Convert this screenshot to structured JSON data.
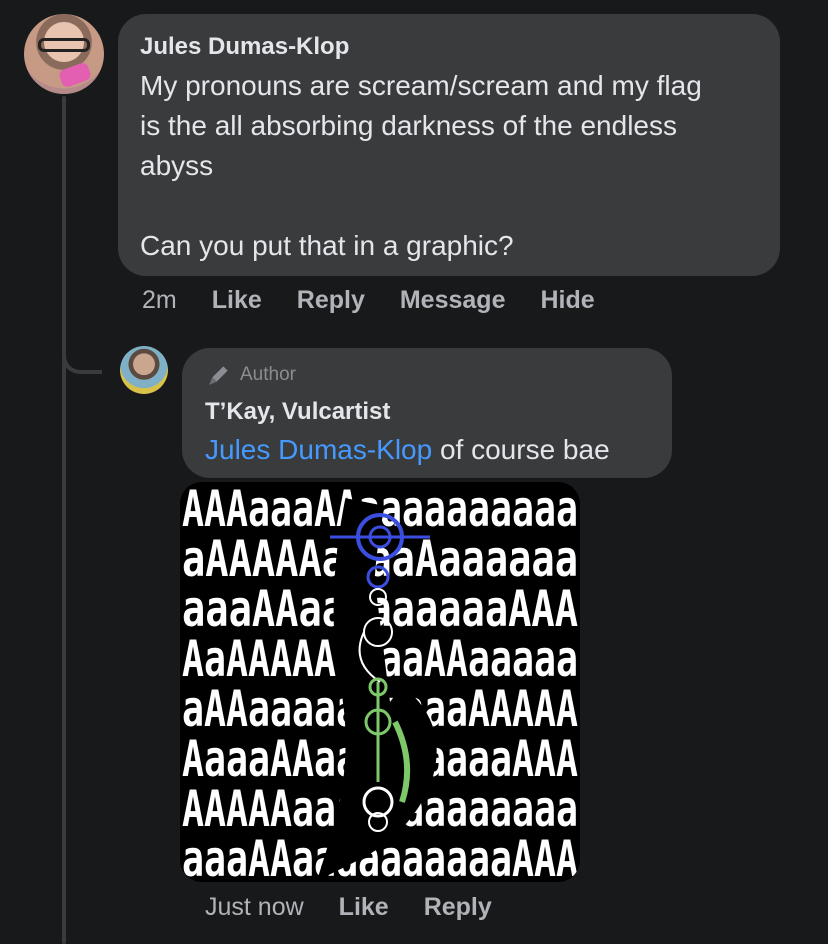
{
  "colors": {
    "background": "#18191a",
    "bubble": "#3a3b3c",
    "text": "#e4e6eb",
    "secondary": "#b0b3b8",
    "mention": "#4599ff",
    "sigil_blue": "#3a4fe0",
    "sigil_green": "#7ec86a"
  },
  "comment": {
    "author": "Jules Dumas-Klop",
    "text": "My pronouns are scream/scream and my flag\nis the all absorbing darkness of the endless\nabyss\n\nCan you put that in a graphic?",
    "time": "2m",
    "actions": {
      "like": "Like",
      "reply": "Reply",
      "message": "Message",
      "hide": "Hide"
    }
  },
  "reply": {
    "badge": "Author",
    "author": "T’Kay, Vulcartist",
    "mention": "Jules Dumas-Klop",
    "text": " of course bae",
    "time": "Just now",
    "actions": {
      "like": "Like",
      "reply": "Reply"
    },
    "image_rows": [
      "AAAaaaAAaaaaaaaaaa",
      "aAAAAAaaaaAaaaaaa",
      "aaaAAaaaaaaaaaAAA",
      "AaAAAAAaaaaAAaaaaa",
      "aAAaaaaaaaaaaAAAAA",
      "AaaaAAaaaaaaaaaAAA",
      "AAAAAaaaaaaaaaaaaa",
      "aaaAAaaaaaaaaaaAAA"
    ]
  },
  "icons": {
    "author_badge": "pencil-icon",
    "main_avatar": "avatar",
    "reply_avatar": "avatar"
  }
}
